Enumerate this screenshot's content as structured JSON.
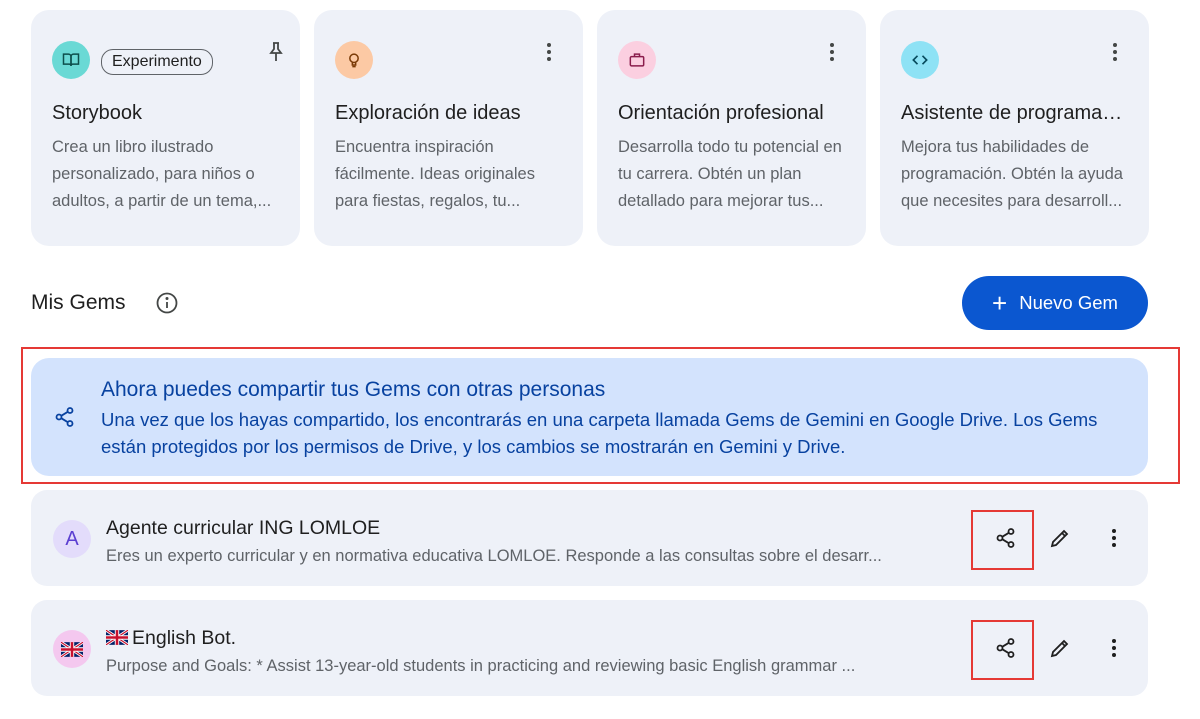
{
  "cards": [
    {
      "icon": "book-icon",
      "icon_bg": "#6ad9d5",
      "badge": "Experimento",
      "title": "Storybook",
      "description": "Crea un libro ilustrado personalizado, para niños o adultos, a partir de un tema,..."
    },
    {
      "icon": "lightbulb-icon",
      "icon_bg": "#fcc9a4",
      "title": "Exploración de ideas",
      "description": "Encuentra inspiración fácilmente. Ideas originales para fiestas, regalos, tu..."
    },
    {
      "icon": "briefcase-icon",
      "icon_bg": "#fbcfe0",
      "title": "Orientación profesional",
      "description": "Desarrolla todo tu potencial en tu carrera. Obtén un plan detallado para mejorar tus..."
    },
    {
      "icon": "code-icon",
      "icon_bg": "#8ee2f5",
      "title": "Asistente de programación",
      "description": "Mejora tus habilidades de programación. Obtén la ayuda que necesites para desarroll..."
    }
  ],
  "my_gems": {
    "title": "Mis Gems",
    "new_gem_label": "Nuevo Gem",
    "accent": "#0b57d0"
  },
  "banner": {
    "title": "Ahora puedes compartir tus Gems con otras personas",
    "text": "Una vez que los hayas compartido, los encontrarás en una carpeta llamada Gems de Gemini en Google Drive. Los Gems están protegidos por los permisos de Drive, y los cambios se mostrarán en Gemini y Drive.",
    "bg": "#d3e3fd",
    "text_color": "#0842a0"
  },
  "gems": [
    {
      "avatar": "A",
      "name": "Agente curricular ING LOMLOE",
      "description": "Eres un experto curricular y en normativa educativa LOMLOE. Responde a las consultas sobre el desarr..."
    },
    {
      "avatar_icon": "uk-flag-icon",
      "name": "English Bot.",
      "description": "Purpose and Goals: * Assist 13-year-old students in practicing and reviewing basic English grammar ..."
    }
  ]
}
